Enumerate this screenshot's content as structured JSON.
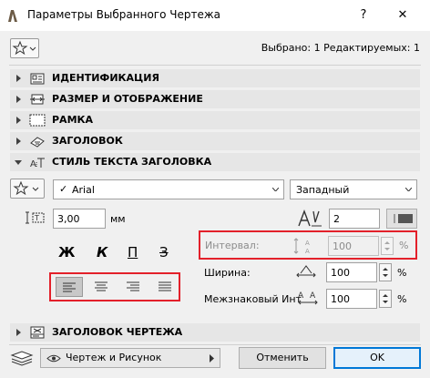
{
  "window": {
    "title": "Параметры Выбранного Чертежа",
    "help_label": "?",
    "close_label": "✕"
  },
  "header": {
    "selected_info": "Выбрано: 1 Редактируемых: 1"
  },
  "sections": [
    {
      "label": "ИДЕНТИФИКАЦИЯ",
      "expanded": false,
      "icon": "id-card-icon"
    },
    {
      "label": "РАЗМЕР И ОТОБРАЖЕНИЕ",
      "expanded": false,
      "icon": "size-display-icon"
    },
    {
      "label": "РАМКА",
      "expanded": false,
      "icon": "frame-icon"
    },
    {
      "label": "ЗАГОЛОВОК",
      "expanded": false,
      "icon": "title-icon"
    },
    {
      "label": "СТИЛЬ ТЕКСТА ЗАГОЛОВКА",
      "expanded": true,
      "icon": "text-style-icon"
    },
    {
      "label": "ЗАГОЛОВОК ЧЕРТЕЖА",
      "expanded": false,
      "icon": "drawing-title-icon"
    }
  ],
  "text_style": {
    "font_check": "✓",
    "font_name": "Arial",
    "script": "Западный",
    "size_value": "3,00",
    "size_unit": "мм",
    "pen_value": "2",
    "style_buttons": [
      "Ж",
      "К",
      "П",
      "З"
    ],
    "spacing_label": "Интервал:",
    "spacing_value": "100",
    "width_label": "Ширина:",
    "width_value": "100",
    "char_spacing_label": "Межзнаковый Инт",
    "char_spacing_value": "100",
    "percent": "%"
  },
  "footer": {
    "layer_label": "Чертеж и Рисунок",
    "cancel_label": "Отменить",
    "ok_label": "OK"
  },
  "colors": {
    "highlight_red": "#e3202a",
    "ok_border": "#0078d7",
    "section_bg": "#e6e6e6"
  }
}
